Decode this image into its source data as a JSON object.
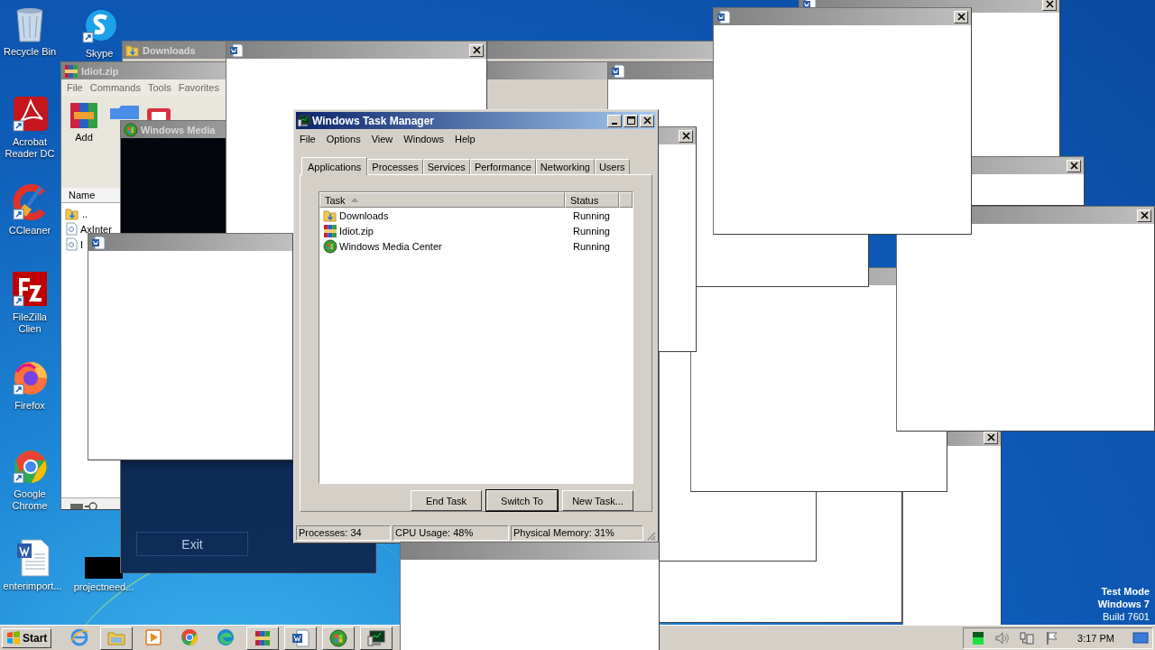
{
  "desktop_icons": [
    {
      "label": "Recycle Bin"
    },
    {
      "label": "Skype"
    },
    {
      "label": "Acrobat Reader DC"
    },
    {
      "label": "CCleaner"
    },
    {
      "label": "FileZilla Clien"
    },
    {
      "label": "Firefox"
    },
    {
      "label": "Google Chrome"
    },
    {
      "label": "enterimport..."
    },
    {
      "label": "projectneed..."
    }
  ],
  "downloads_window": {
    "title": "Downloads"
  },
  "winrar_window": {
    "title": "Idiot.zip",
    "menu": [
      "File",
      "Commands",
      "Tools",
      "Favorites"
    ],
    "toolbar": [
      "Add"
    ],
    "columns": [
      "Name"
    ],
    "rows": [
      "..",
      "AxInter",
      "I"
    ]
  },
  "media_center_window": {
    "title": "Windows Media",
    "button": "Exit"
  },
  "task_manager": {
    "title": "Windows Task Manager",
    "menu": [
      "File",
      "Options",
      "View",
      "Windows",
      "Help"
    ],
    "tabs": [
      {
        "label": "Applications",
        "selected": true
      },
      {
        "label": "Processes",
        "selected": false
      },
      {
        "label": "Services",
        "selected": false
      },
      {
        "label": "Performance",
        "selected": false
      },
      {
        "label": "Networking",
        "selected": false
      },
      {
        "label": "Users",
        "selected": false
      }
    ],
    "columns": [
      "Task",
      "Status"
    ],
    "rows": [
      {
        "task": "Downloads",
        "status": "Running"
      },
      {
        "task": "Idiot.zip",
        "status": "Running"
      },
      {
        "task": "Windows Media Center",
        "status": "Running"
      }
    ],
    "buttons": [
      "End Task",
      "Switch To",
      "New Task..."
    ],
    "status_bar": [
      "Processes: 34",
      "CPU Usage: 48%",
      "Physical Memory: 31%"
    ]
  },
  "taskbar": {
    "start": "Start",
    "clock": "3:17 PM"
  },
  "os_notice": [
    "Test Mode",
    "Windows 7",
    "Build 7601"
  ]
}
